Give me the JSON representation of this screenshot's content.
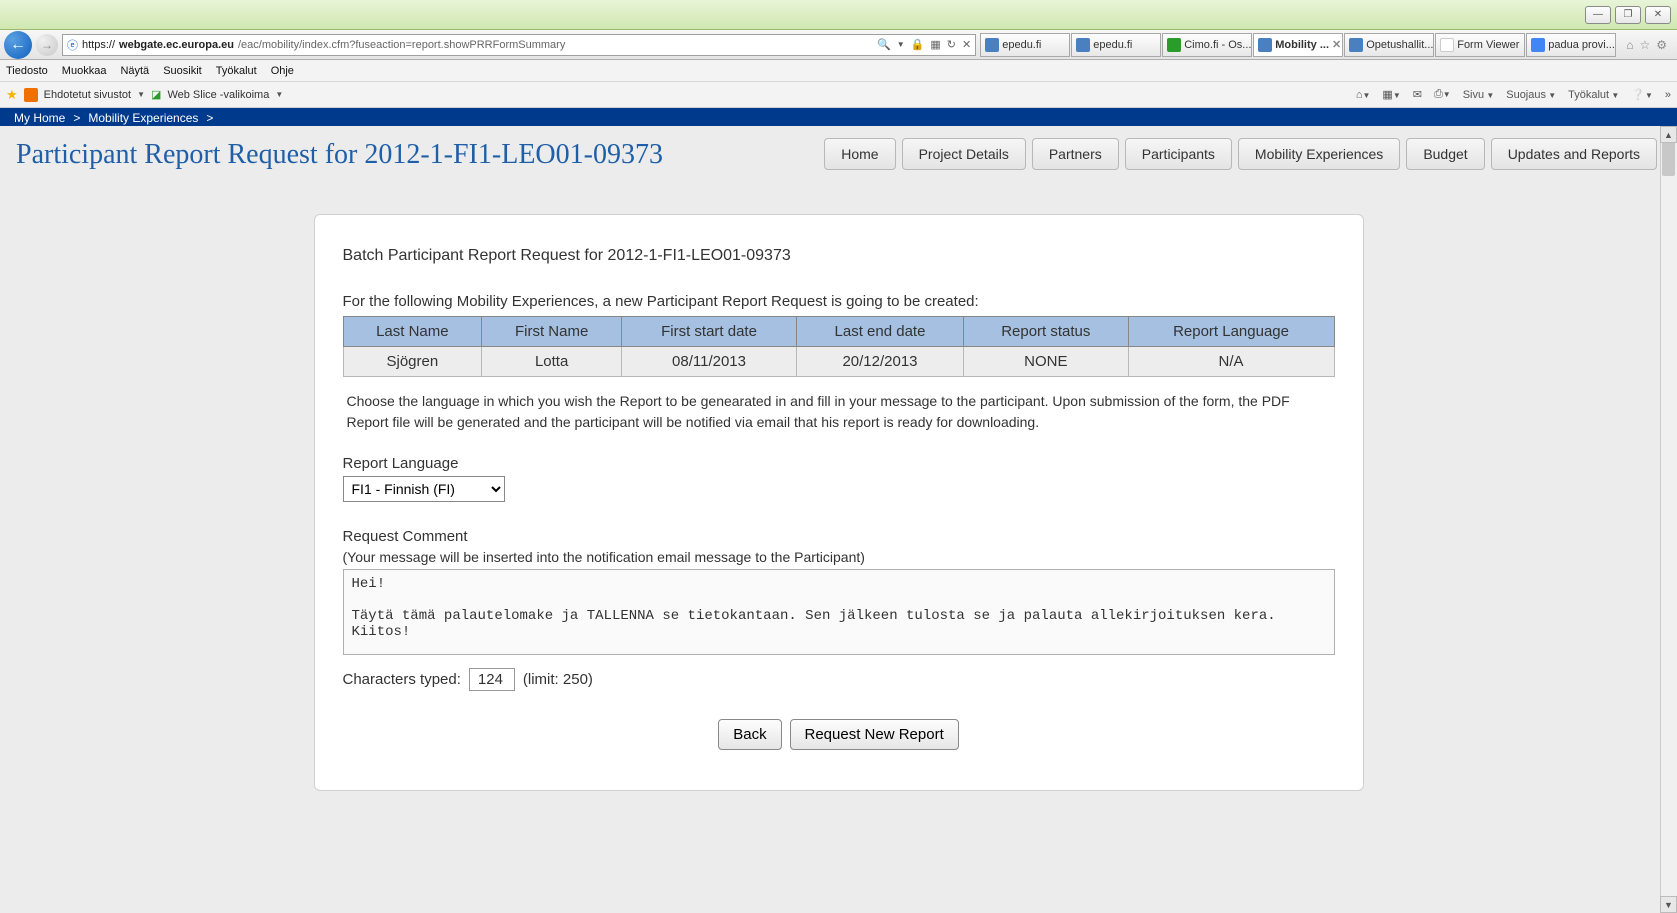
{
  "chrome": {
    "min": "—",
    "max": "❐",
    "close": "✕"
  },
  "nav": {
    "url_prefix": "https://",
    "url_domain": "webgate.ec.europa.eu",
    "url_path": "/eac/mobility/index.cfm?fuseaction=report.showPRRFormSummary",
    "search_glyph": "🔍",
    "lock": "🔒",
    "refresh": "↻",
    "stop": "✕"
  },
  "tabs": [
    {
      "label": "epedu.fi"
    },
    {
      "label": "epedu.fi"
    },
    {
      "label": "Cimo.fi - Os..."
    },
    {
      "label": "Mobility ...",
      "active": true,
      "closable": true
    },
    {
      "label": "Opetushallit..."
    },
    {
      "label": "Form Viewer"
    },
    {
      "label": "padua provi..."
    }
  ],
  "menu": [
    "Tiedosto",
    "Muokkaa",
    "Näytä",
    "Suosikit",
    "Työkalut",
    "Ohje"
  ],
  "favbar": {
    "item1": "Ehdotetut sivustot",
    "item2": "Web Slice -valikoima",
    "right": [
      "Sivu",
      "Suojaus",
      "Työkalut"
    ]
  },
  "breadcrumb": {
    "home": "My Home",
    "sep": ">",
    "current": "Mobility Experiences"
  },
  "navtabs": [
    "Home",
    "Project Details",
    "Partners",
    "Participants",
    "Mobility Experiences",
    "Budget",
    "Updates and Reports"
  ],
  "title": "Participant Report Request for 2012-1-FI1-LEO01-09373",
  "card": {
    "heading": "Batch Participant Report Request for 2012-1-FI1-LEO01-09373",
    "subheading": "For the following Mobility Experiences, a new Participant Report Request is going to be created:",
    "columns": [
      "Last Name",
      "First Name",
      "First start date",
      "Last end date",
      "Report status",
      "Report Language"
    ],
    "row": [
      "Sjögren",
      "Lotta",
      "08/11/2013",
      "20/12/2013",
      "NONE",
      "N/A"
    ],
    "instruction": "Choose the language in which you wish the Report to be genearated in and fill in your message to the participant. Upon submission of the form, the PDF Report file will be generated and the participant will be notified via email that his report is ready for downloading.",
    "lang_label": "Report Language",
    "lang_value": "FI1 - Finnish (FI)",
    "comment_label": "Request Comment",
    "comment_hint": "(Your message will be inserted into the notification email message to the Participant)",
    "comment_value": "Hei!\n\nTäytä tämä palautelomake ja TALLENNA se tietokantaan. Sen jälkeen tulosta se ja palauta allekirjoituksen kera. Kiitos!",
    "chars_label": "Characters typed:",
    "chars_value": "124",
    "chars_limit": "(limit: 250)",
    "btn_back": "Back",
    "btn_submit": "Request New Report"
  }
}
